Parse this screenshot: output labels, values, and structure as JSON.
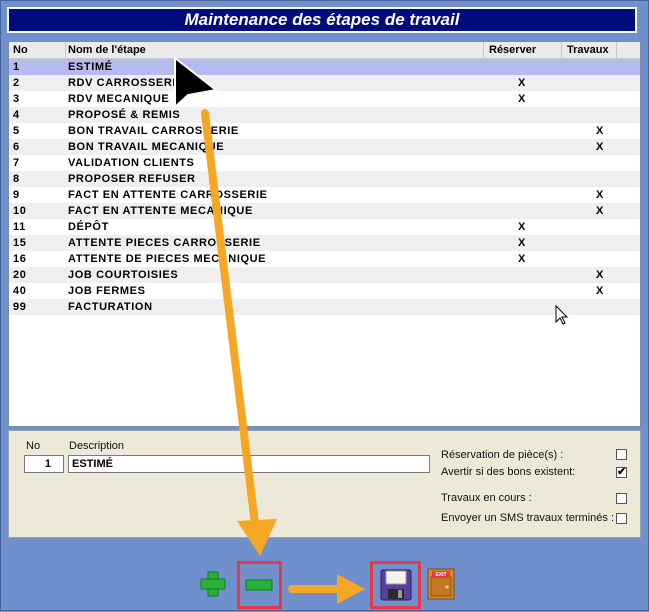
{
  "window": {
    "title": "Maintenance des étapes de travail"
  },
  "grid": {
    "columns": {
      "no": "No",
      "name": "Nom de l'étape",
      "reserve": "Réserver",
      "works": "Travaux"
    },
    "rows": [
      {
        "no": "1",
        "name": "ESTIMÉ",
        "reserve": "",
        "works": ""
      },
      {
        "no": "2",
        "name": "RDV CARROSSERIE",
        "reserve": "X",
        "works": ""
      },
      {
        "no": "3",
        "name": "RDV MECANIQUE",
        "reserve": "X",
        "works": ""
      },
      {
        "no": "4",
        "name": "PROPOSÉ & REMIS",
        "reserve": "",
        "works": ""
      },
      {
        "no": "5",
        "name": "BON TRAVAIL CARROSSERIE",
        "reserve": "",
        "works": "X"
      },
      {
        "no": "6",
        "name": "BON TRAVAIL MECANIQUE",
        "reserve": "",
        "works": "X"
      },
      {
        "no": "7",
        "name": "VALIDATION CLIENTS",
        "reserve": "",
        "works": ""
      },
      {
        "no": "8",
        "name": "PROPOSER REFUSER",
        "reserve": "",
        "works": ""
      },
      {
        "no": "9",
        "name": "FACT EN ATTENTE CARROSSERIE",
        "reserve": "",
        "works": "X"
      },
      {
        "no": "10",
        "name": "FACT EN ATTENTE MECANIQUE",
        "reserve": "",
        "works": "X"
      },
      {
        "no": "11",
        "name": "DÉPÔT",
        "reserve": "X",
        "works": ""
      },
      {
        "no": "15",
        "name": "ATTENTE PIECES CARROSSERIE",
        "reserve": "X",
        "works": ""
      },
      {
        "no": "16",
        "name": "ATTENTE DE PIECES MECANIQUE",
        "reserve": "X",
        "works": ""
      },
      {
        "no": "20",
        "name": "JOB COURTOISIES",
        "reserve": "",
        "works": "X"
      },
      {
        "no": "40",
        "name": "JOB FERMES",
        "reserve": "",
        "works": "X"
      },
      {
        "no": "99",
        "name": "FACTURATION",
        "reserve": "",
        "works": ""
      }
    ],
    "selected_index": 0
  },
  "form": {
    "no_label": "No",
    "no_value": "1",
    "desc_label": "Description",
    "desc_value": "ESTIMÉ",
    "options": [
      {
        "label": "Réservation de pièce(s) :",
        "checked": false
      },
      {
        "label": "Avertir si des bons existent:",
        "checked": true
      },
      {
        "label": "Travaux en cours :",
        "checked": false
      },
      {
        "label": "Envoyer un SMS travaux terminés :",
        "checked": false
      }
    ]
  },
  "toolbar": {
    "add_icon": "plus-icon",
    "delete_icon": "minus-icon",
    "save_icon": "floppy-disk-icon",
    "exit_icon": "exit-door-icon",
    "exit_text": "EXIT"
  },
  "colors": {
    "title_bg": "#000c7c",
    "window_bg": "#6f90cc",
    "selected_row": "#b7b9f3",
    "arrow": "#f5a623",
    "highlight": "#e53a45"
  }
}
